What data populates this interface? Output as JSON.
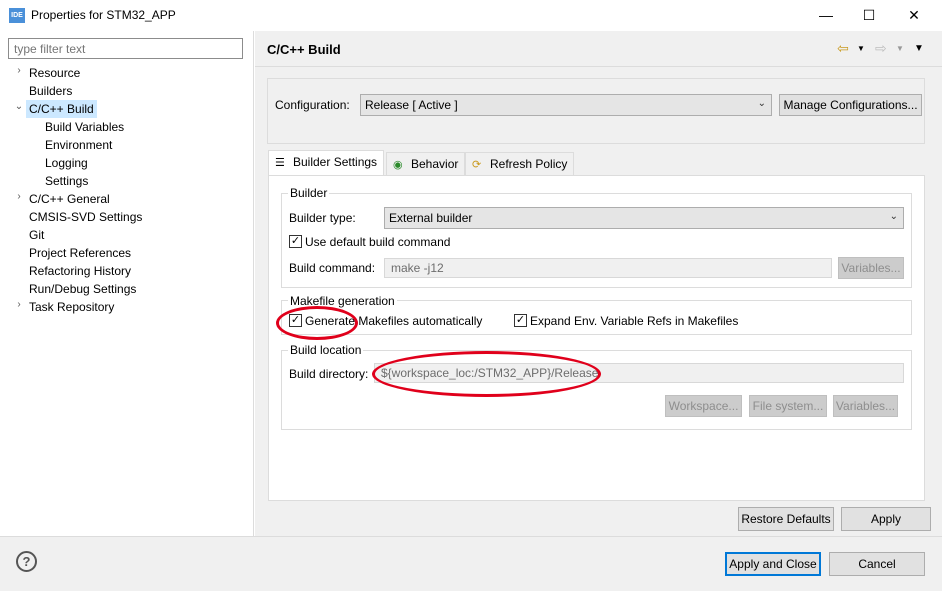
{
  "window": {
    "app_icon": "IDE",
    "title": "Properties for STM32_APP",
    "minimize": "—",
    "maximize": "☐",
    "close": "✕"
  },
  "filter": {
    "placeholder": "type filter text"
  },
  "tree": [
    {
      "label": "Resource",
      "arrow": "›",
      "indent": 0
    },
    {
      "label": "Builders",
      "arrow": "",
      "indent": 0
    },
    {
      "label": "C/C++ Build",
      "arrow": "⌄",
      "indent": 0,
      "selected": true
    },
    {
      "label": "Build Variables",
      "arrow": "",
      "indent": 1
    },
    {
      "label": "Environment",
      "arrow": "",
      "indent": 1
    },
    {
      "label": "Logging",
      "arrow": "",
      "indent": 1
    },
    {
      "label": "Settings",
      "arrow": "",
      "indent": 1
    },
    {
      "label": "C/C++ General",
      "arrow": "›",
      "indent": 0
    },
    {
      "label": "CMSIS-SVD Settings",
      "arrow": "",
      "indent": 0
    },
    {
      "label": "Git",
      "arrow": "",
      "indent": 0
    },
    {
      "label": "Project References",
      "arrow": "",
      "indent": 0
    },
    {
      "label": "Refactoring History",
      "arrow": "",
      "indent": 0
    },
    {
      "label": "Run/Debug Settings",
      "arrow": "",
      "indent": 0
    },
    {
      "label": "Task Repository",
      "arrow": "›",
      "indent": 0
    }
  ],
  "page": {
    "title": "C/C++ Build",
    "back_icon": "⇦",
    "forward_icon": "⇨",
    "menu_icon": "▼",
    "configuration_label": "Configuration:",
    "configuration_value": "Release  [ Active ]",
    "manage_button": "Manage Configurations..."
  },
  "tabs": [
    {
      "label": "Builder Settings",
      "icon": "☰",
      "active": true
    },
    {
      "label": "Behavior",
      "icon": "◉",
      "active": false
    },
    {
      "label": "Refresh Policy",
      "icon": "⟳",
      "active": false
    }
  ],
  "builder": {
    "group_title": "Builder",
    "type_label": "Builder type:",
    "type_value": "External builder",
    "use_default_label": "Use default build command",
    "use_default_checked": true,
    "command_label": "Build command:",
    "command_value": "make -j12",
    "variables_button": "Variables..."
  },
  "makefile": {
    "group_title": "Makefile generation",
    "generate_label": "Generate Makefiles automatically",
    "generate_checked": true,
    "expand_label": "Expand Env. Variable Refs in Makefiles",
    "expand_checked": true
  },
  "location": {
    "group_title": "Build location",
    "dir_label": "Build directory:",
    "dir_value": "${workspace_loc:/STM32_APP}/Release",
    "workspace_button": "Workspace...",
    "filesystem_button": "File system...",
    "variables_button": "Variables..."
  },
  "footer": {
    "restore_defaults": "Restore Defaults",
    "apply": "Apply",
    "help_icon": "?",
    "apply_and_close": "Apply and Close",
    "cancel": "Cancel"
  },
  "colors": {
    "selection": "#cce8ff",
    "annotation": "#e0001b",
    "primary_border": "#0078d7"
  }
}
